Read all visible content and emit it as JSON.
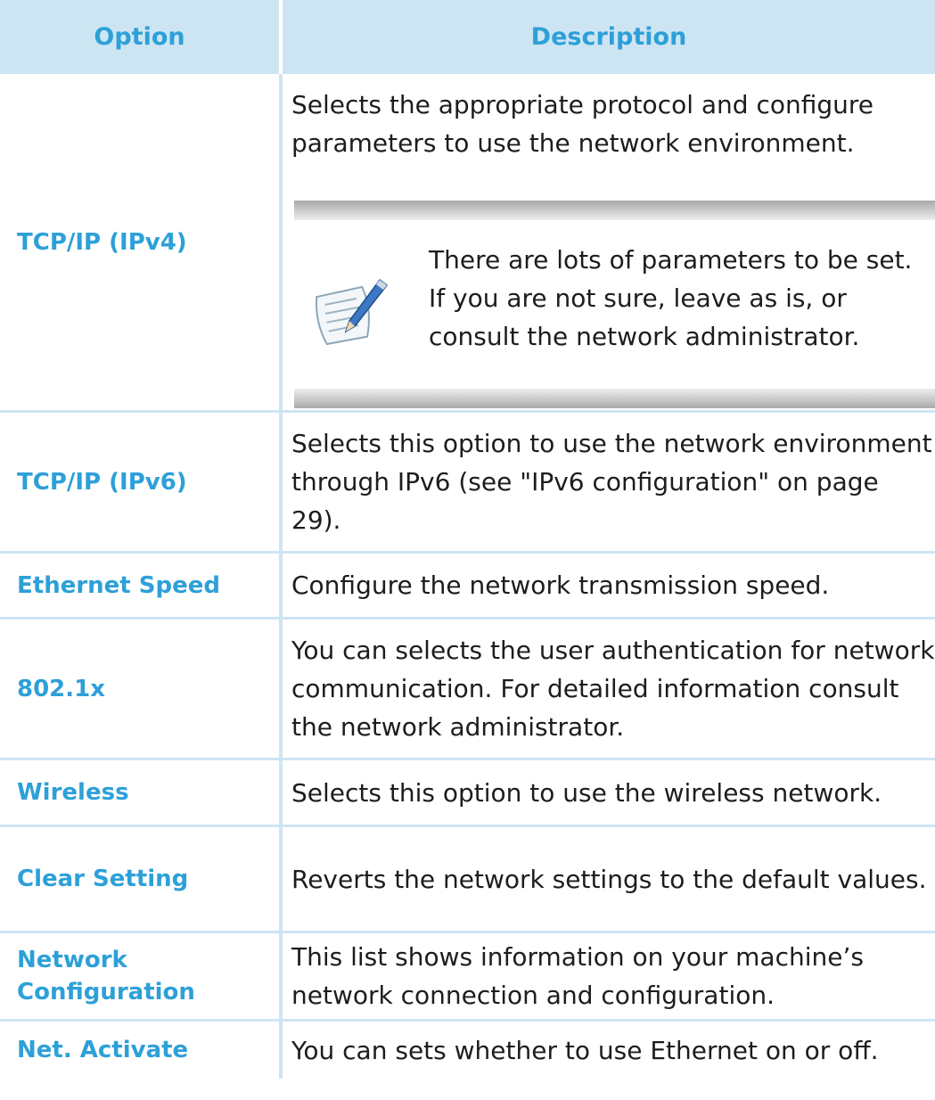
{
  "header": {
    "option": "Option",
    "description": "Description"
  },
  "rows": [
    {
      "option": "TCP/IP (IPv4)",
      "description": "Selects the appropriate protocol and configure parameters to use the network environment.",
      "note": "There are lots of parameters to be set. If you are not sure, leave as is, or consult the network administrator."
    },
    {
      "option": "TCP/IP (IPv6)",
      "description": "Selects this option to use the network environment through IPv6 (see \"IPv6 configuration\" on page 29)."
    },
    {
      "option": "Ethernet Speed",
      "description": "Configure the network transmission speed."
    },
    {
      "option": "802.1x",
      "description": "You can selects the user authentication for network communication. For detailed information consult the network administrator."
    },
    {
      "option": "Wireless",
      "description": "Selects this option to use the wireless network."
    },
    {
      "option": "Clear Setting",
      "description": "Reverts the network settings to the default values."
    },
    {
      "option": "Network Configuration",
      "description": "This list shows information on your machine’s network connection and configuration."
    },
    {
      "option": "Net. Activate",
      "description": "You can sets whether to use Ethernet on or off."
    }
  ],
  "colors": {
    "accent": "#2da0d8",
    "header_bg": "#cde5f3",
    "text": "#1d1d1d"
  },
  "icons": {
    "note": "note-pencil-icon"
  }
}
